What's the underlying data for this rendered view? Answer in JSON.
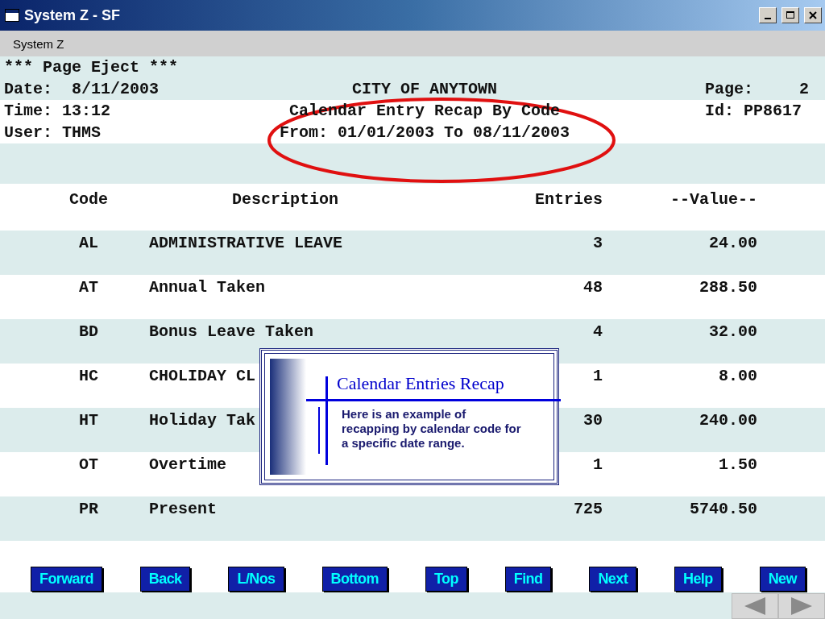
{
  "window": {
    "title": "System Z - SF"
  },
  "menu": [
    {
      "label": "System Z"
    }
  ],
  "report_header": [
    {
      "left": "*** Page Eject ***"
    },
    {
      "left": "Date:  8/11/2003",
      "center": "CITY OF ANYTOWN",
      "right_label": "Page:",
      "right_value": "2"
    },
    {
      "left": "Time: 13:12",
      "center": "Calendar Entry Recap By Code",
      "right_label": "Id: PP8617"
    },
    {
      "left": "User: THMS",
      "center": "From: 01/01/2003 To 08/11/2003"
    }
  ],
  "table": {
    "columns": [
      "Code",
      "Description",
      "Entries",
      "--Value--"
    ],
    "rows": [
      {
        "code": "AL",
        "description": "ADMINISTRATIVE LEAVE",
        "entries": "3",
        "value": "24.00"
      },
      {
        "code": "AT",
        "description": "Annual Taken",
        "entries": "48",
        "value": "288.50"
      },
      {
        "code": "BD",
        "description": "Bonus Leave Taken",
        "entries": "4",
        "value": "32.00"
      },
      {
        "code": "HC",
        "description": "CHOLIDAY CL",
        "entries": "1",
        "value": "8.00"
      },
      {
        "code": "HT",
        "description": "Holiday Tak",
        "entries": "30",
        "value": "240.00"
      },
      {
        "code": "OT",
        "description": "Overtime",
        "entries": "1",
        "value": "1.50"
      },
      {
        "code": "PR",
        "description": "Present",
        "entries": "725",
        "value": "5740.50"
      }
    ]
  },
  "callout": {
    "title": "Calendar Entries Recap",
    "body_lines": [
      "Here is an example of",
      "recapping by calendar code for",
      "a specific date range."
    ]
  },
  "buttons": [
    "Forward",
    "Back",
    "L/Nos",
    "Bottom",
    "Top",
    "Find",
    "Next",
    "Help",
    "New"
  ]
}
